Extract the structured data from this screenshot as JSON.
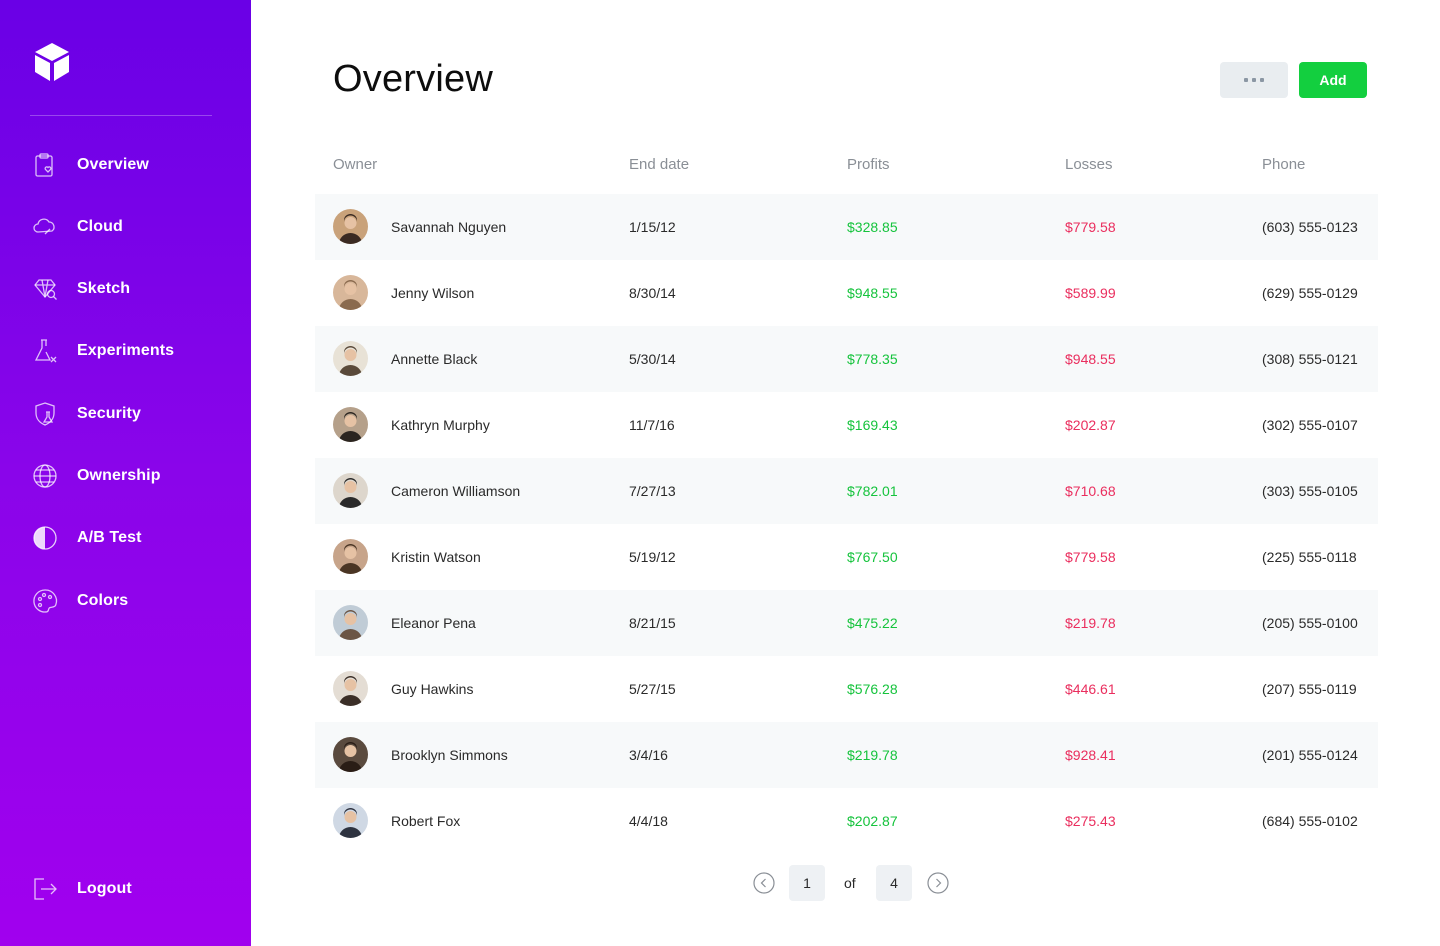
{
  "sidebar": {
    "items": [
      {
        "label": "Overview",
        "icon": "clipboard-heart-icon"
      },
      {
        "label": "Cloud",
        "icon": "cloud-icon"
      },
      {
        "label": "Sketch",
        "icon": "diamond-search-icon"
      },
      {
        "label": "Experiments",
        "icon": "flask-icon"
      },
      {
        "label": "Security",
        "icon": "shield-icon"
      },
      {
        "label": "Ownership",
        "icon": "globe-icon"
      },
      {
        "label": "A/B Test",
        "icon": "half-circle-icon"
      },
      {
        "label": "Colors",
        "icon": "palette-icon"
      }
    ],
    "logout_label": "Logout"
  },
  "header": {
    "title": "Overview",
    "add_label": "Add"
  },
  "table": {
    "columns": [
      "Owner",
      "End date",
      "Profits",
      "Losses",
      "Phone"
    ],
    "rows": [
      {
        "owner": "Savannah Nguyen",
        "end_date": "1/15/12",
        "profit": "$328.85",
        "loss": "$779.58",
        "phone": "(603) 555-0123"
      },
      {
        "owner": "Jenny Wilson",
        "end_date": "8/30/14",
        "profit": "$948.55",
        "loss": "$589.99",
        "phone": "(629) 555-0129"
      },
      {
        "owner": "Annette Black",
        "end_date": "5/30/14",
        "profit": "$778.35",
        "loss": "$948.55",
        "phone": "(308) 555-0121"
      },
      {
        "owner": "Kathryn Murphy",
        "end_date": "11/7/16",
        "profit": "$169.43",
        "loss": "$202.87",
        "phone": "(302) 555-0107"
      },
      {
        "owner": "Cameron Williamson",
        "end_date": "7/27/13",
        "profit": "$782.01",
        "loss": "$710.68",
        "phone": "(303) 555-0105"
      },
      {
        "owner": "Kristin Watson",
        "end_date": "5/19/12",
        "profit": "$767.50",
        "loss": "$779.58",
        "phone": "(225) 555-0118"
      },
      {
        "owner": "Eleanor Pena",
        "end_date": "8/21/15",
        "profit": "$475.22",
        "loss": "$219.78",
        "phone": "(205) 555-0100"
      },
      {
        "owner": "Guy Hawkins",
        "end_date": "5/27/15",
        "profit": "$576.28",
        "loss": "$446.61",
        "phone": "(207) 555-0119"
      },
      {
        "owner": "Brooklyn Simmons",
        "end_date": "3/4/16",
        "profit": "$219.78",
        "loss": "$928.41",
        "phone": "(201) 555-0124"
      },
      {
        "owner": "Robert Fox",
        "end_date": "4/4/18",
        "profit": "$202.87",
        "loss": "$275.43",
        "phone": "(684) 555-0102"
      }
    ]
  },
  "pagination": {
    "current": "1",
    "of_label": "of",
    "total": "4"
  },
  "colors": {
    "sidebar_top": "#6a00e6",
    "sidebar_bottom": "#a100ee",
    "profit": "#15c33c",
    "loss": "#ea2e5e",
    "add_button": "#13cf3f"
  }
}
